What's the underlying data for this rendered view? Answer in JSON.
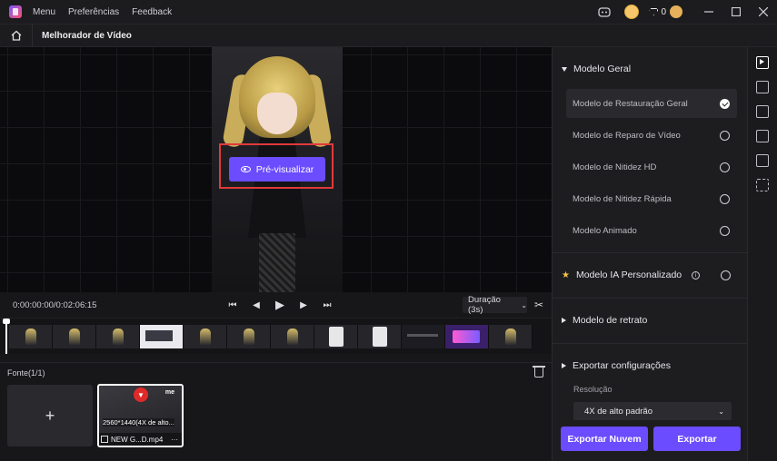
{
  "titlebar": {
    "menu_items": [
      "Menu",
      "Preferências",
      "Feedback"
    ],
    "credits": "0",
    "icons": [
      "discord-icon",
      "avatar",
      "diamond-icon",
      "gift-icon",
      "minimize-icon",
      "maximize-icon",
      "close-icon"
    ]
  },
  "subbar": {
    "page_title": "Melhorador de Vídeo",
    "home_icon": "home-icon"
  },
  "preview": {
    "button_label": "Pré-visualizar",
    "highlight_color": "#e03a3a",
    "accent": "#6b4cff"
  },
  "playback": {
    "timecode": "0:00:00:00/0:02:06:15",
    "duration_label": "Duração (3s)"
  },
  "source": {
    "label": "Fonte(1/1)",
    "add_symbol": "+",
    "file": {
      "resolution": "2560*1440(4X de alto...",
      "name": "NEW G...D.mp4",
      "more": "···",
      "brand": "me"
    }
  },
  "panel": {
    "general_section": "Modelo Geral",
    "models": [
      {
        "label": "Modelo de Restauração Geral",
        "selected": true
      },
      {
        "label": "Modelo de Reparo de Vídeo",
        "selected": false
      },
      {
        "label": "Modelo de Nitidez HD",
        "selected": false
      },
      {
        "label": "Modelo de Nitidez Rápida",
        "selected": false
      },
      {
        "label": "Modelo Animado",
        "selected": false
      }
    ],
    "custom_section": "Modelo IA Personalizado",
    "portrait_section": "Modelo de retrato",
    "export_section": "Exportar configurações",
    "resolution_label": "Resolução",
    "resolution_value": "4X de alto padrão",
    "cloud_export_label": "Exportar Nuvem",
    "export_label": "Exportar"
  }
}
